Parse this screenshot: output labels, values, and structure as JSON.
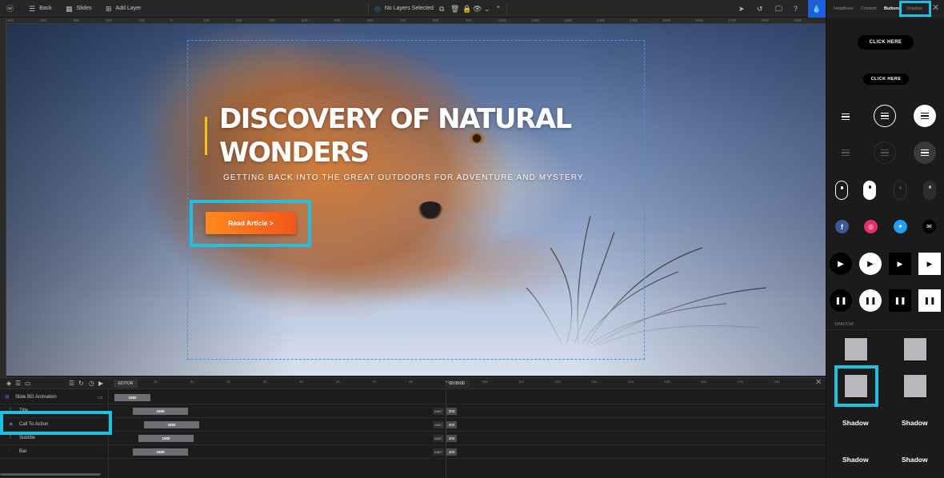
{
  "topbar": {
    "back": "Back",
    "slides": "Slides",
    "add_layer": "Add Layer",
    "selection_status": "No Layers Selected"
  },
  "ruler": [
    "-500",
    "-400",
    "-300",
    "-200",
    "-100",
    "0",
    "100",
    "200",
    "300",
    "400",
    "500",
    "600",
    "700",
    "800",
    "900",
    "1000",
    "1100",
    "1200",
    "1300",
    "1400",
    "1500",
    "1600",
    "1700",
    "1800",
    "1900",
    "2000"
  ],
  "canvas": {
    "title": "DISCOVERY OF NATURAL WONDERS",
    "subtitle": "GETTING BACK INTO THE GREAT OUTDOORS FOR ADVENTURE AND MYSTERY.",
    "cta_label": "Read Article >",
    "accent_color": "#f0c419",
    "cta_color": "#f2561c"
  },
  "panel": {
    "tabs": [
      "Headlines",
      "Content",
      "Buttons",
      "Shadow"
    ],
    "active_tab": "Buttons",
    "highlighted_tab": "Shadow",
    "pill_large": "CLICK HERE",
    "pill_small": "CLICK HERE",
    "section_shadow": "SHADOW",
    "shadow_texts": [
      "Shadow",
      "Shadow",
      "Shadow",
      "Shadow"
    ]
  },
  "timeline": {
    "editor_tag": "EDITOR",
    "time": "00:09:00",
    "marks": [
      "1s",
      "2s",
      "3s",
      "4s",
      "5s",
      "6s",
      "7s",
      "8s",
      "9s",
      "10s",
      "11s",
      "12s",
      "13s",
      "14s",
      "15s",
      "16s",
      "17s",
      "18s"
    ],
    "rows": [
      {
        "label": "Slide BG Animation",
        "bar": "1000",
        "wait": "",
        "wait_val": ""
      },
      {
        "label": "Title",
        "bar": "1500",
        "wait": "WAIT",
        "wait_val": "300"
      },
      {
        "label": "Call To Action",
        "bar": "1500",
        "wait": "WAIT",
        "wait_val": "300"
      },
      {
        "label": "Subtitle",
        "bar": "1500",
        "wait": "WAIT",
        "wait_val": "300"
      },
      {
        "label": "Bar",
        "bar": "1500",
        "wait": "WAIT",
        "wait_val": "300"
      }
    ]
  }
}
